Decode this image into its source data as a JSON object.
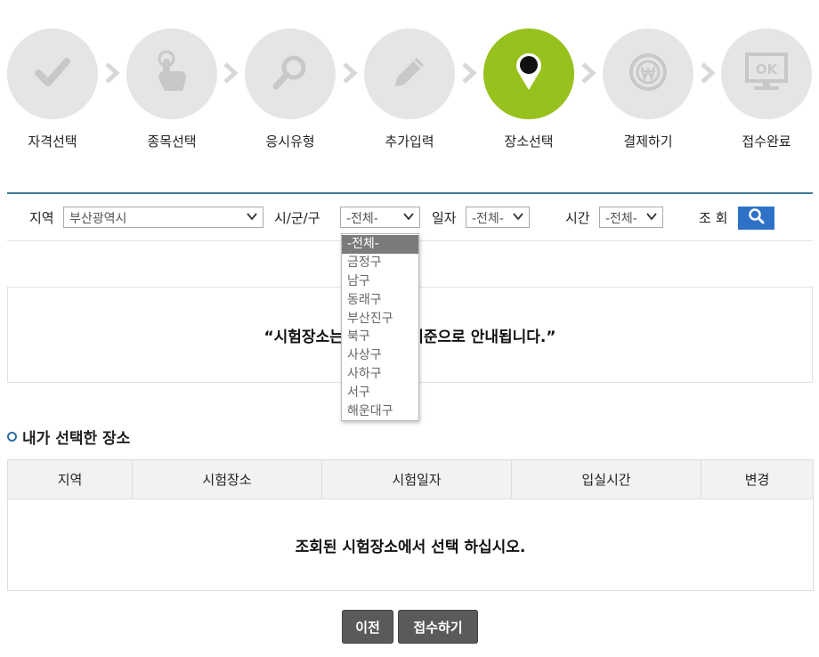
{
  "steps": [
    {
      "label": "자격선택",
      "icon": "check-icon",
      "active": false
    },
    {
      "label": "종목선택",
      "icon": "hand-pointer-icon",
      "active": false
    },
    {
      "label": "응시유형",
      "icon": "magnifier-icon",
      "active": false
    },
    {
      "label": "추가입력",
      "icon": "pencil-icon",
      "active": false
    },
    {
      "label": "장소선택",
      "icon": "map-pin-icon",
      "active": true
    },
    {
      "label": "결제하기",
      "icon": "won-coin-icon",
      "active": false
    },
    {
      "label": "접수완료",
      "icon": "monitor-ok-icon",
      "active": false
    }
  ],
  "filter": {
    "region_label": "지역",
    "region_value": "부산광역시",
    "district_label": "시/군/구",
    "district_value": "-전체-",
    "date_label": "일자",
    "date_value": "-전체-",
    "time_label": "시간",
    "time_value": "-전체-",
    "search_label": "조 회"
  },
  "district_options": [
    "-전체-",
    "금정구",
    "남구",
    "동래구",
    "부산진구",
    "북구",
    "사상구",
    "사하구",
    "서구",
    "해운대구"
  ],
  "notice": {
    "text": "“시험장소는 입실시간 기준으로 안내됩니다.”"
  },
  "selected": {
    "title": "내가 선택한 장소",
    "headers": [
      "지역",
      "시험장소",
      "시험일자",
      "입실시간",
      "변경"
    ],
    "empty_message": "조회된 시험장소에서 선택 하십시오."
  },
  "buttons": {
    "prev": "이전",
    "submit": "접수하기"
  },
  "colors": {
    "active_step": "#97c11c",
    "inactive_step": "#e5e5e5",
    "accent": "#2e72c7",
    "divider": "#3d7a99"
  }
}
